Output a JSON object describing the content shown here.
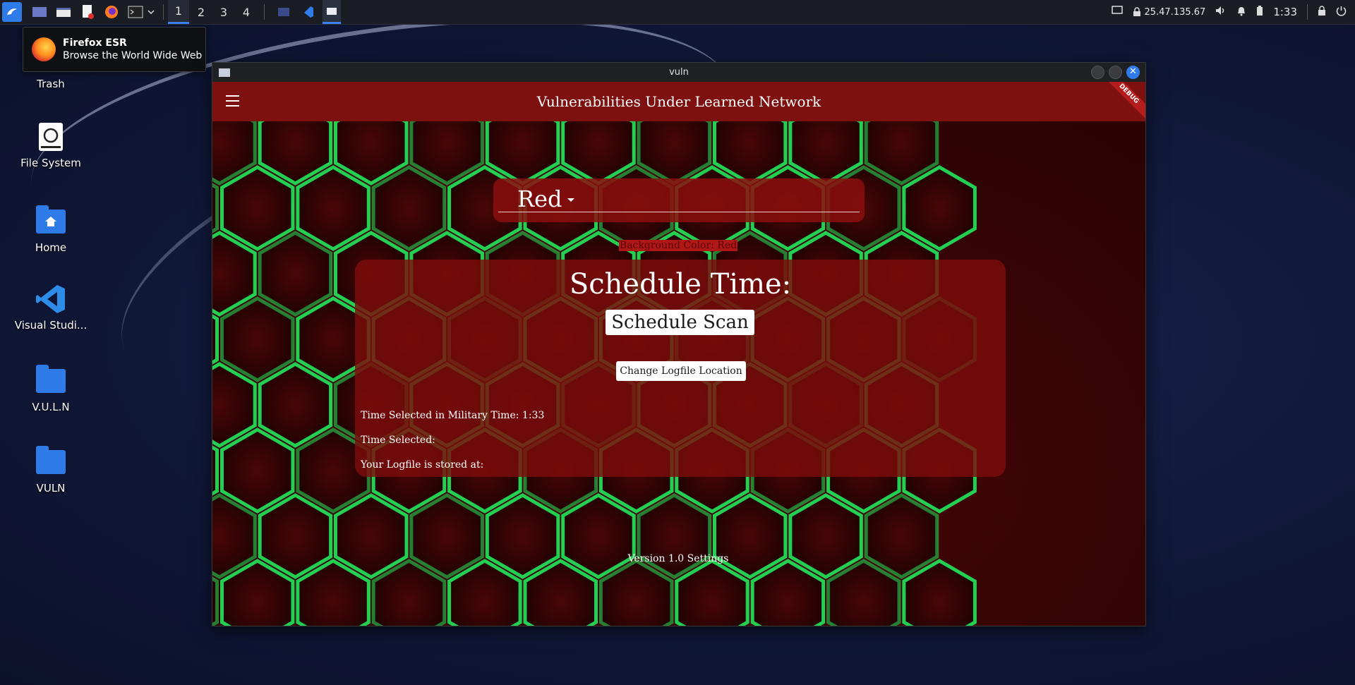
{
  "taskbar": {
    "workspaces": [
      "1",
      "2",
      "3",
      "4"
    ],
    "active_workspace": "1",
    "network_address": "25.47.135.67",
    "clock": "1:33"
  },
  "tooltip": {
    "title": "Firefox ESR",
    "subtitle": "Browse the World Wide Web"
  },
  "desktop": {
    "icons": [
      {
        "label": "Trash"
      },
      {
        "label": "File System"
      },
      {
        "label": "Home"
      },
      {
        "label": "Visual Studi..."
      },
      {
        "label": "V.U.L.N"
      },
      {
        "label": "VULN"
      }
    ]
  },
  "window": {
    "title": "vuln"
  },
  "app": {
    "title": "Vulnerabilities Under Learned Network",
    "debug_banner": "DEBUG",
    "color_dropdown": {
      "value": "Red"
    },
    "background_label": "Background Color: Red",
    "panel": {
      "title": "Schedule Time:",
      "schedule_button": "Schedule Scan",
      "logfile_button": "Change Logfile Location",
      "military_time": "Time Selected in Military Time: 1:33",
      "time_selected": "Time Selected:",
      "logfile_stored": "Your Logfile is stored at:"
    },
    "footer": "Version 1.0 Settings"
  },
  "colors": {
    "appbar": "#7f1010",
    "accent_blue": "#2f7be8",
    "hex_glow": "#22e65a"
  }
}
